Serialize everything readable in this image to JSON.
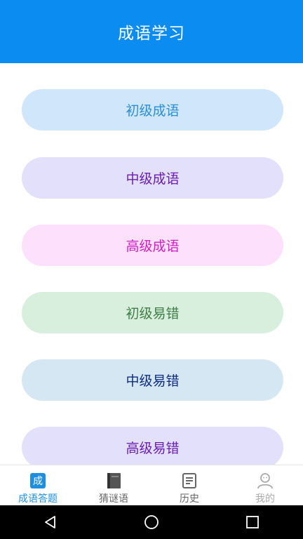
{
  "header": {
    "title": "成语学习"
  },
  "menu": [
    {
      "label": "初级成语",
      "bg": "#cfe6fb",
      "color": "#2a8fd4"
    },
    {
      "label": "中级成语",
      "bg": "#e3e0fb",
      "color": "#6a1db0"
    },
    {
      "label": "高级成语",
      "bg": "#fde0fb",
      "color": "#cf1fc4"
    },
    {
      "label": "初级易错",
      "bg": "#d8efdd",
      "color": "#3f7d46"
    },
    {
      "label": "中级易错",
      "bg": "#d6e7f4",
      "color": "#0d2c7c"
    },
    {
      "label": "高级易错",
      "bg": "#e3e0fb",
      "color": "#6a1db0"
    }
  ],
  "tabs": [
    {
      "label": "成语答题",
      "icon": "idiom-quiz-icon",
      "icon_char": "成",
      "active": true,
      "color": "#1e8fe0"
    },
    {
      "label": "猜谜语",
      "icon": "book-icon",
      "active": false,
      "color": "#666666"
    },
    {
      "label": "历史",
      "icon": "document-icon",
      "active": false,
      "color": "#666666"
    },
    {
      "label": "我的",
      "icon": "user-icon",
      "active": false,
      "color": "#aaaaaa"
    }
  ],
  "colors": {
    "accent": "#0b8cf0",
    "tab_active": "#1e8fe0"
  }
}
